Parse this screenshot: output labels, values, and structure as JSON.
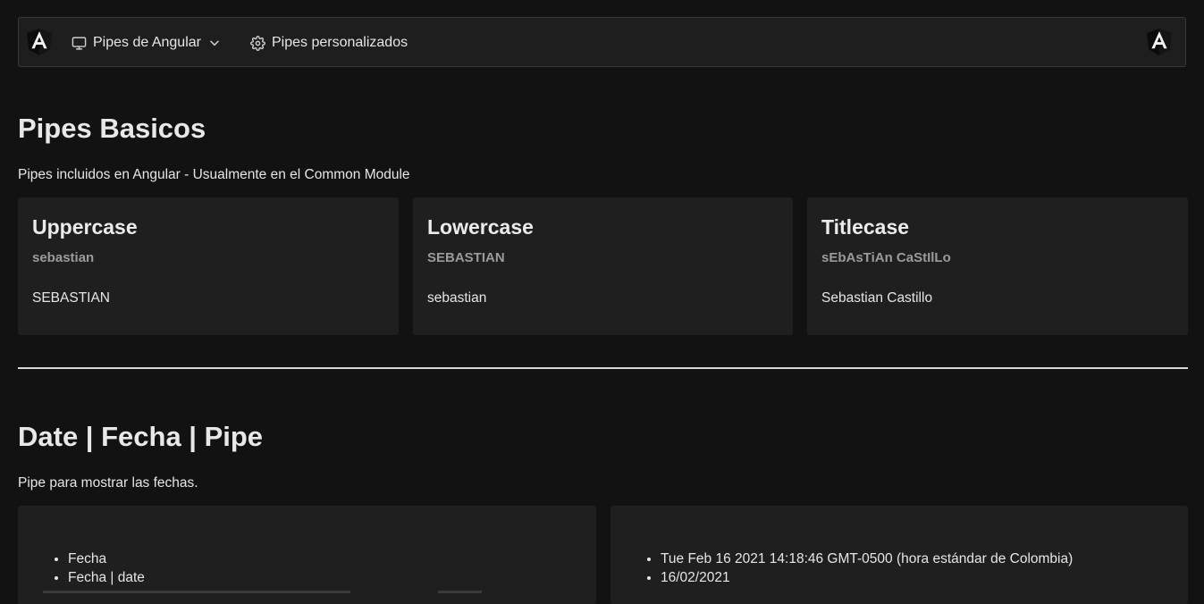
{
  "navbar": {
    "logo_icon": "angular-logo",
    "menu_items": [
      {
        "label": "Pipes de Angular",
        "icon": "monitor-icon",
        "has_dropdown": true
      },
      {
        "label": "Pipes personalizados",
        "icon": "gear-icon"
      }
    ]
  },
  "basic": {
    "title": "Pipes Basicos",
    "subtitle": "Pipes incluidos en Angular - Usualmente en el Common Module",
    "cards": [
      {
        "title": "Uppercase",
        "input": "sebastian",
        "output": "SEBASTIAN"
      },
      {
        "title": "Lowercase",
        "input": "SEBASTIAN",
        "output": "sebastian"
      },
      {
        "title": "Titlecase",
        "input": "sEbAsTiAn CaStIlLo",
        "output": "Sebastian Castillo"
      }
    ]
  },
  "date": {
    "title": "Date | Fecha | Pipe",
    "subtitle": "Pipe para mostrar las fechas.",
    "left_items": [
      "Fecha",
      "Fecha | date"
    ],
    "right_items": [
      "Tue Feb 16 2021 14:18:46 GMT-0500 (hora estándar de Colombia)",
      "16/02/2021"
    ]
  },
  "colors": {
    "background": "#121212",
    "navbar": "#1e1e1e",
    "card": "#1f1f1f",
    "muted_text": "#9b9b9b",
    "angular_red": "#dd0031"
  }
}
